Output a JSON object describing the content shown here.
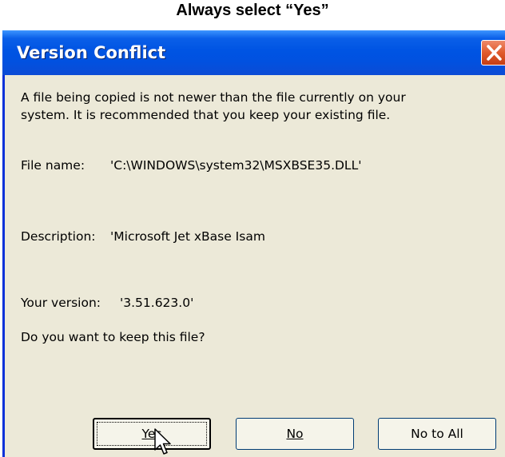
{
  "caption": "Always select “Yes”",
  "dialog": {
    "title": "Version Conflict",
    "message_line1": "A file being copied is not newer than the file currently on your",
    "message_line2": "system. It is recommended that you keep your existing file.",
    "file_name_label": "File name:",
    "file_name_value": "'C:\\WINDOWS\\system32\\MSXBSE35.DLL'",
    "description_label": "Description:",
    "description_value": "'Microsoft Jet xBase Isam",
    "version_label": "Your version:",
    "version_value": "'3.51.623.0'",
    "question": "Do you want to keep this file?",
    "buttons": {
      "yes": "Yes",
      "no": "No",
      "no_to_all": "No to All"
    }
  },
  "icons": {
    "close": "close-icon",
    "cursor": "mouse-pointer-icon"
  },
  "colors": {
    "titlebar": "#0054e3",
    "close_button": "#e05a2c",
    "dialog_bg": "#ece9d8"
  }
}
